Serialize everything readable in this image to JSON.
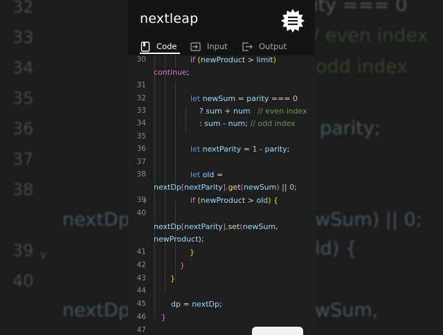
{
  "app": {
    "logo_text": "nextleap",
    "menu_icon": "hamburger-badge-icon"
  },
  "tabs": [
    {
      "label": "Code",
      "icon": "file-icon",
      "active": true
    },
    {
      "label": "Input",
      "icon": "input-icon",
      "active": false
    },
    {
      "label": "Output",
      "icon": "output-icon",
      "active": false
    }
  ],
  "code_lines": {
    "l30_num": "30",
    "l30_a": "if",
    "l30_b": " (",
    "l30_c": "newProduct",
    "l30_d": " > ",
    "l30_e": "limit",
    "l30_f": ")",
    "l30_g": "continue",
    "l30_h": ";",
    "l31_num": "31",
    "l32_num": "32",
    "l32_a": "let",
    "l32_b": "newSum",
    "l32_c": " = ",
    "l32_d": "parity",
    "l32_e": " === ",
    "l32_f": "0",
    "l33_num": "33",
    "l33_a": "? ",
    "l33_b": "sum",
    "l33_c": " + ",
    "l33_d": "num",
    "l33_e": "// even index",
    "l34_num": "34",
    "l34_a": ": ",
    "l34_b": "sum",
    "l34_c": " - ",
    "l34_d": "num",
    "l34_e": ";  ",
    "l34_f": "// odd index",
    "l35_num": "35",
    "l36_num": "36",
    "l36_a": "let",
    "l36_b": "nextParity",
    "l36_c": " = ",
    "l36_d": "1",
    "l36_e": " - ",
    "l36_f": "parity",
    "l36_g": ";",
    "l37_num": "37",
    "l38_num": "38",
    "l38_a": "let",
    "l38_b": "old",
    "l38_c": " =",
    "l38w_a": "nextDp",
    "l38w_b": "[",
    "l38w_c": "nextParity",
    "l38w_d": "]",
    "l38w_e": ".",
    "l38w_f": "get",
    "l38w_g": "(",
    "l38w_h": "newSum",
    "l38w_i": ")",
    "l38w_j": " || ",
    "l38w_k": "0",
    "l38w_l": ";",
    "l39_num": "39",
    "l39_chev": "v",
    "l39_a": "if",
    "l39_b": " (",
    "l39_c": "newProduct",
    "l39_d": " > ",
    "l39_e": "old",
    "l39_f": ") ",
    "l39_g": "{",
    "l40_num": "40",
    "l40w_a": "nextDp",
    "l40w_b": "[",
    "l40w_c": "nextParity",
    "l40w_d": "]",
    "l40w_e": ".",
    "l40w_f": "set",
    "l40w_g": "(",
    "l40w_h": "newSum",
    "l40w_i": ",",
    "l40w2_a": "newProduct",
    "l40w2_b": ");",
    "l41_num": "41",
    "l41_a": "}",
    "l42_num": "42",
    "l42_a": "}",
    "l43_num": "43",
    "l43_a": "}",
    "l44_num": "44",
    "l45_num": "45",
    "l45_a": "dp",
    "l45_b": " = ",
    "l45_c": "nextDp",
    "l45_d": ";",
    "l46_num": "46",
    "l46_a": "}",
    "l47_num": "47"
  },
  "background": {
    "n32": "32",
    "n33": "33",
    "n34": "34",
    "n35": "35",
    "n36": "36",
    "n37": "37",
    "n38": "38",
    "n39": "39",
    "chev39": "v",
    "n40": "40",
    "r32": "ity === 0",
    "r33": "/ even index",
    "r34": "odd index",
    "r36": "parity;",
    "l_nextdp1": "nextDp",
    "r_nextdp1": "wSum) || 0;",
    "r_old": "ld) {",
    "l_nextdp2": "nextDp",
    "r_nextdp2": "wSum,"
  }
}
